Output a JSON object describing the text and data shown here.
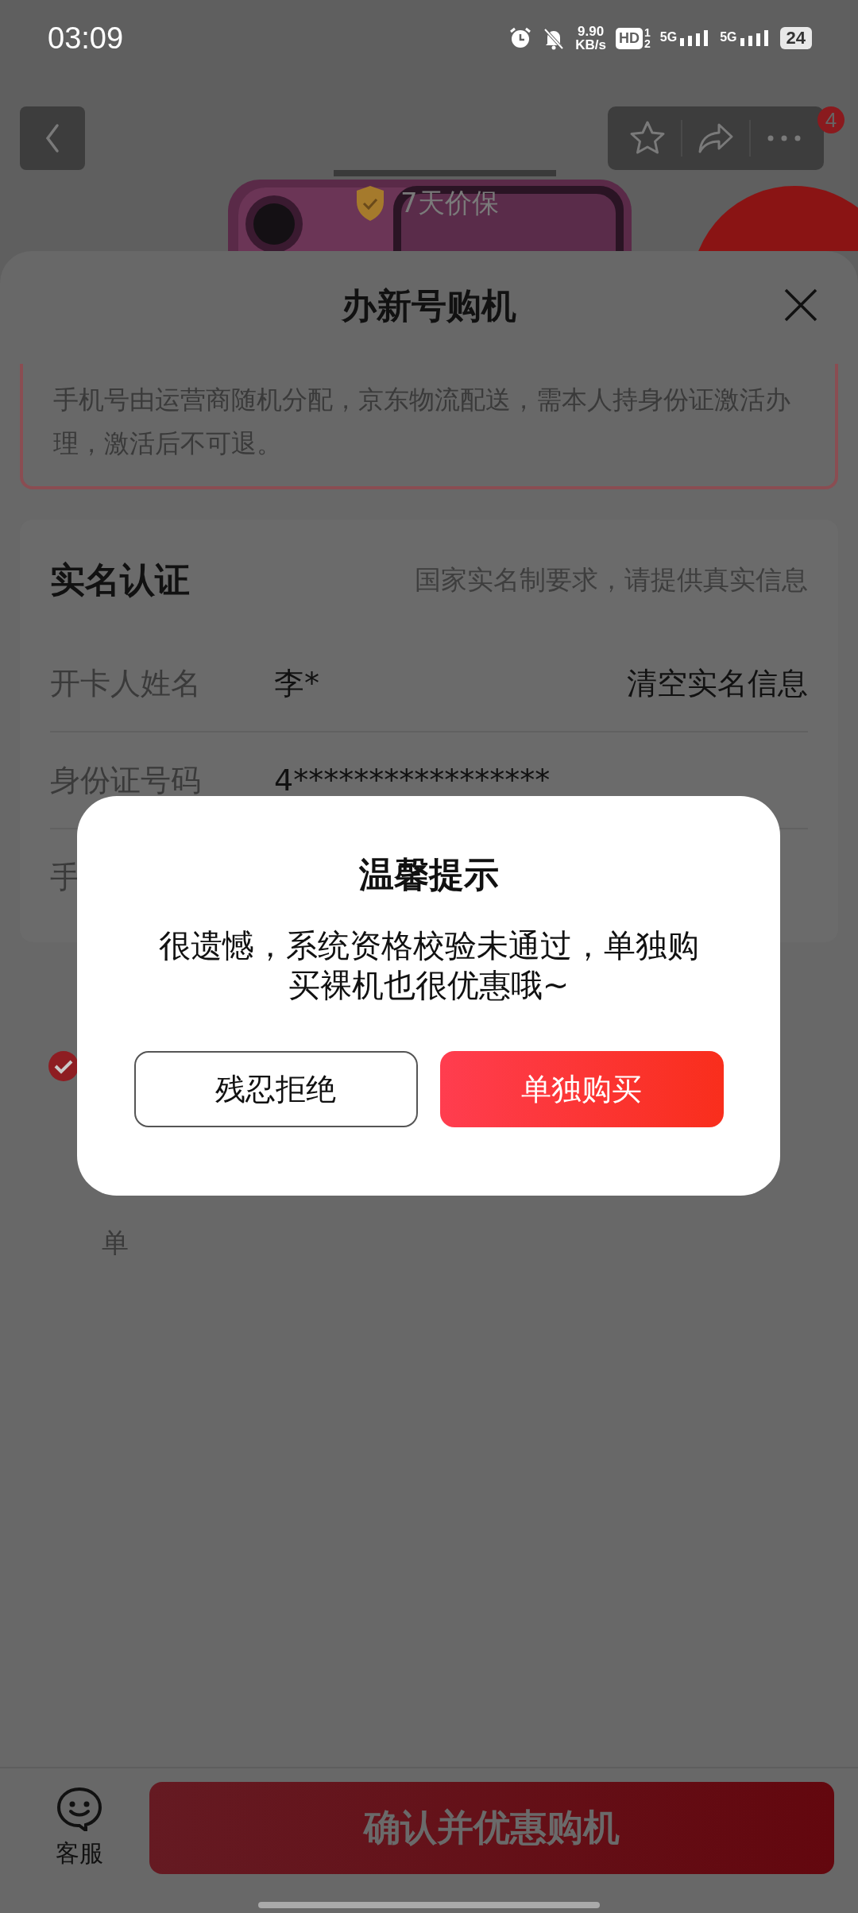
{
  "status_bar": {
    "time": "03:09",
    "network_speed": "9.90",
    "network_speed_unit": "KB/s",
    "hd": {
      "label": "HD",
      "sims": [
        "1",
        "2"
      ]
    },
    "signals": [
      {
        "label": "5G"
      },
      {
        "label": "5G"
      }
    ],
    "battery": "24"
  },
  "nav": {
    "more_badge": "4"
  },
  "product": {
    "badge": "7天价保"
  },
  "sheet": {
    "title": "办新号购机",
    "notice": "手机号由运营商随机分配，京东物流配送，需本人持身份证激活办理，激活后不可退。",
    "card": {
      "title": "实名认证",
      "hint": "国家实名制要求，请提供真实信息",
      "rows": [
        {
          "label": "开卡人姓名",
          "value": "李*",
          "action": "清空实名信息"
        },
        {
          "label": "身份证号码",
          "value": "4*****************"
        },
        {
          "label": "手"
        }
      ]
    },
    "agreement": {
      "checked": true,
      "text": "单"
    }
  },
  "dialog": {
    "title": "温馨提示",
    "message": "很遗憾，系统资格校验未通过，单独购买裸机也很优惠哦~",
    "buttons": [
      {
        "label": "残忍拒绝",
        "kind": "secondary"
      },
      {
        "label": "单独购买",
        "kind": "primary"
      }
    ]
  },
  "bottom_bar": {
    "service_label": "客服",
    "confirm_label": "确认并优惠购机"
  }
}
